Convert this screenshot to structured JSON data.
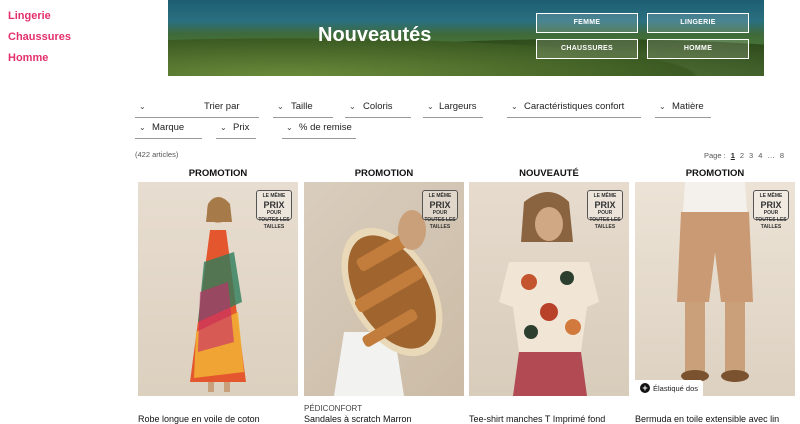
{
  "sidebar": {
    "items": [
      {
        "label": "Lingerie"
      },
      {
        "label": "Chaussures"
      },
      {
        "label": "Homme"
      }
    ]
  },
  "banner": {
    "title": "Nouveautés",
    "buttons": [
      {
        "label": "FEMME"
      },
      {
        "label": "LINGERIE"
      },
      {
        "label": "CHAUSSURES"
      },
      {
        "label": "HOMME"
      }
    ]
  },
  "filters": {
    "sort": "Trier par",
    "size": "Taille",
    "colors": "Coloris",
    "widths": "Largeurs",
    "comfort": "Caractéristiques confort",
    "material": "Matière",
    "brand": "Marque",
    "price": "Prix",
    "discount": "% de remise"
  },
  "results": {
    "count": "(422 articles)"
  },
  "pagination": {
    "label": "Page :",
    "pages": [
      "1",
      "2",
      "3",
      "4",
      "…",
      "8"
    ],
    "current": "1"
  },
  "stamp": {
    "top": "LE MÊME",
    "mid": "PRIX",
    "bottom": "POUR TOUTES LES TAILLES"
  },
  "products": [
    {
      "badge": "PROMOTION",
      "brand": "",
      "name": "Robe longue en voile de coton",
      "tag": ""
    },
    {
      "badge": "PROMOTION",
      "brand": "PÉDICONFORT",
      "name": "Sandales à scratch Marron",
      "tag": ""
    },
    {
      "badge": "NOUVEAUTÉ",
      "brand": "",
      "name": "Tee-shirt manches T Imprimé fond",
      "tag": ""
    },
    {
      "badge": "PROMOTION",
      "brand": "",
      "name": "Bermuda en toile extensible avec lin",
      "tag": "Élastiqué dos"
    }
  ],
  "colors": {
    "accent": "#e3306c"
  }
}
